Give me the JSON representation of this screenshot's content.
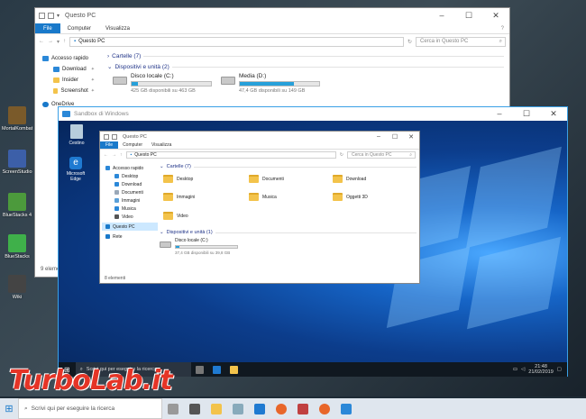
{
  "desktop_icons": [
    {
      "label": "MortalKombat",
      "color": "#7a5a2a"
    },
    {
      "label": "Cestino",
      "color": "#9fb7c9"
    },
    {
      "label": "ScreenStudio",
      "color": "#3c5fa8"
    },
    {
      "label": "BlueStacks 4",
      "color": "#4c9a3c"
    },
    {
      "label": "BlueStacks",
      "color": "#3fb04a"
    },
    {
      "label": "Wiki",
      "color": "#444444"
    }
  ],
  "outer_explorer": {
    "title": "Questo PC",
    "ribbon": {
      "file": "File",
      "tabs": [
        "Computer",
        "Visualizza"
      ]
    },
    "address": "Questo PC",
    "search_placeholder": "Cerca in Questo PC",
    "nav": {
      "quick_access": "Accesso rapido",
      "items": [
        "Download",
        "Insider",
        "Screenshot"
      ],
      "onedrive": "OneDrive",
      "recycle": "Ri"
    },
    "section_folders": "Cartelle (7)",
    "section_devices": "Dispositivi e unità (2)",
    "drives": [
      {
        "name": "Disco locale (C:)",
        "free": "425 GB disponibili su 463 GB",
        "used": 0.08
      },
      {
        "name": "Media (D:)",
        "free": "47,4 GB disponibili su 149 GB",
        "used": 0.68
      }
    ],
    "status": "9 eleme"
  },
  "sandbox": {
    "title": "Sandbox di Windows",
    "icons": [
      {
        "label": "Cestino",
        "color": "#b7cddc"
      },
      {
        "label": "Microsoft Edge",
        "color": "#1f7ad1"
      }
    ],
    "taskbar": {
      "search": "Scrivi qui per eseguire la ricerca",
      "time": "21:48",
      "date": "21/02/2019"
    }
  },
  "inner_explorer": {
    "title": "Questo PC",
    "ribbon": {
      "file": "File",
      "tabs": [
        "Computer",
        "Visualizza"
      ]
    },
    "address": "Questo PC",
    "search_placeholder": "Cerca in Questo PC",
    "nav": {
      "quick_access": "Accesso rapido",
      "items": [
        "Desktop",
        "Download",
        "Documenti",
        "Immagini",
        "Musica",
        "Video"
      ],
      "this_pc": "Questo PC",
      "network": "Rete"
    },
    "section_folders": "Cartelle (7)",
    "folders": [
      "Desktop",
      "Documenti",
      "Download",
      "Immagini",
      "Musica",
      "Oggetti 3D",
      "Video"
    ],
    "section_devices": "Dispositivi e unità (1)",
    "drive": {
      "name": "Disco locale (C:)",
      "free": "37,4 GB disponibili su 39,8 GB",
      "used": 0.06
    },
    "status": "8 elementi"
  },
  "taskbar": {
    "search": "Scrivi qui per eseguire la ricerca"
  },
  "watermark": "TurboLab.it"
}
